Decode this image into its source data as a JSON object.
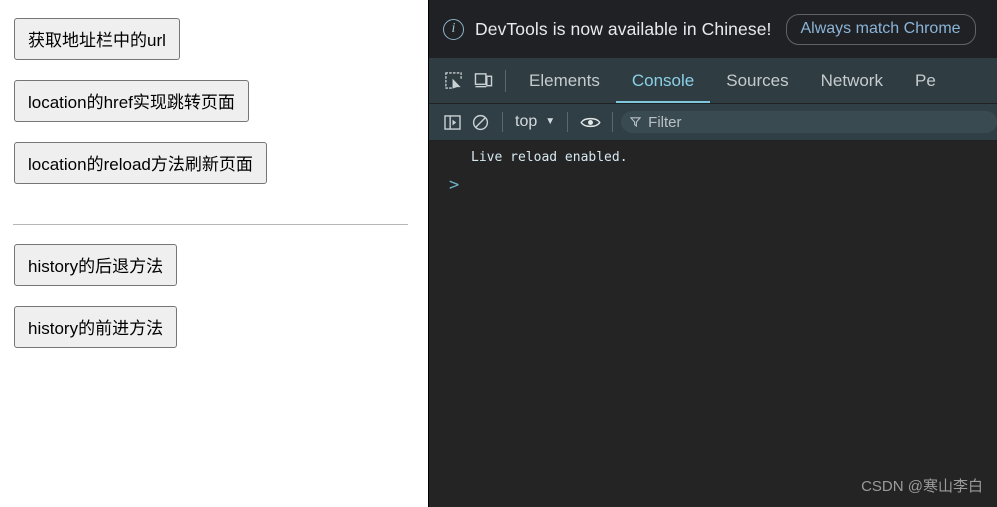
{
  "page": {
    "buttons": [
      {
        "label": "获取地址栏中的url",
        "name": "get-url-button"
      },
      {
        "label": "location的href实现跳转页面",
        "name": "location-href-button"
      },
      {
        "label": "location的reload方法刷新页面",
        "name": "location-reload-button"
      },
      {
        "label": "history的后退方法",
        "name": "history-back-button"
      },
      {
        "label": "history的前进方法",
        "name": "history-forward-button"
      }
    ]
  },
  "devtools": {
    "banner": {
      "icon": "info-icon",
      "message": "DevTools is now available in Chinese!",
      "action_label": "Always match Chrome"
    },
    "tabbar": {
      "inspect_icon": "inspect-element-icon",
      "device_icon": "device-toolbar-icon",
      "tabs": [
        {
          "label": "Elements",
          "active": false
        },
        {
          "label": "Console",
          "active": true
        },
        {
          "label": "Sources",
          "active": false
        },
        {
          "label": "Network",
          "active": false
        },
        {
          "label": "Pe",
          "active": false
        }
      ]
    },
    "toolbar": {
      "sidebar_icon": "console-sidebar-icon",
      "clear_icon": "clear-console-icon",
      "context_value": "top",
      "caret": "▼",
      "eye_icon": "live-expression-eye-icon",
      "filter_icon": "▽",
      "filter_placeholder": "Filter"
    },
    "console": {
      "messages": [
        "Live reload enabled."
      ],
      "prompt": ">"
    },
    "watermark": "CSDN @寒山李白"
  },
  "colors": {
    "banner_bg": "#202124",
    "tabbar_bg": "#2f3c42",
    "toolbar_bg": "#303e45",
    "console_bg": "#242424",
    "accent": "#7ec8dd",
    "button_face": "#efefef",
    "button_border": "#767676"
  }
}
